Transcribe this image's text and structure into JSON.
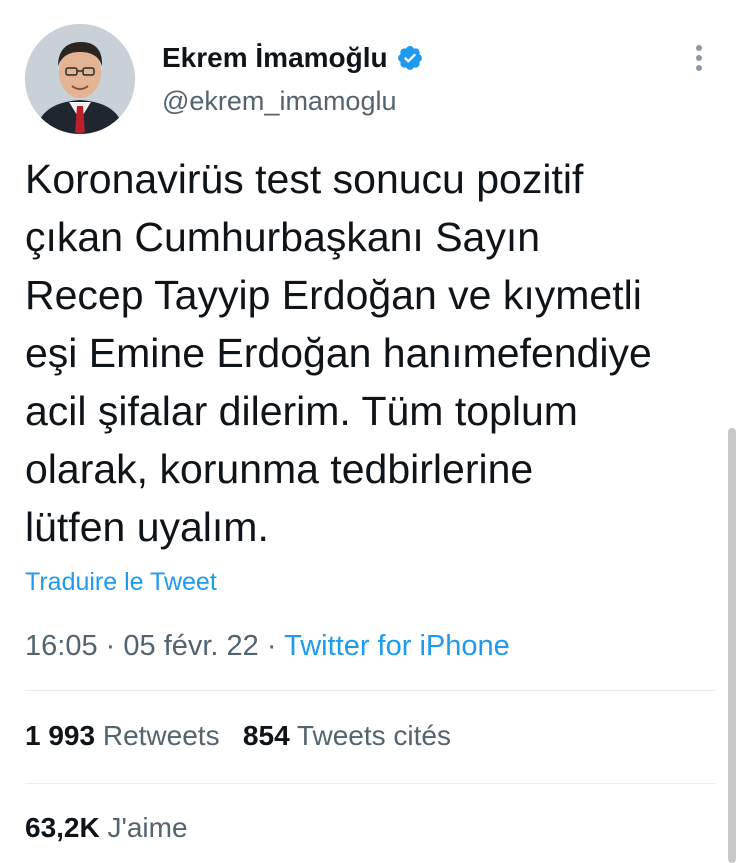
{
  "author": {
    "display_name": "Ekrem İmamoğlu",
    "handle": "@ekrem_imamoglu",
    "verified": true,
    "avatar_icon": "profile-photo"
  },
  "tweet": {
    "lines": [
      "Koronavirüs test sonucu pozitif",
      "çıkan Cumhurbaşkanı Sayın",
      "Recep Tayyip Erdoğan ve kıymetli",
      "eşi Emine Erdoğan hanımefendiye",
      "acil şifalar dilerim. Tüm toplum",
      "olarak, korunma tedbirlerine",
      "lütfen uyalım."
    ],
    "translate_label": "Traduire le Tweet",
    "time": "16:05",
    "date": "05 févr. 22",
    "separator": "·",
    "source": "Twitter for iPhone"
  },
  "stats": {
    "retweets_count": "1 993",
    "retweets_label": "Retweets",
    "quotes_count": "854",
    "quotes_label": "Tweets cités",
    "likes_count": "63,2K",
    "likes_label": "J'aime"
  },
  "colors": {
    "accent": "#1d9bf0",
    "text": "#0f1419",
    "secondary": "#536471",
    "divider": "#e6ecf0"
  }
}
